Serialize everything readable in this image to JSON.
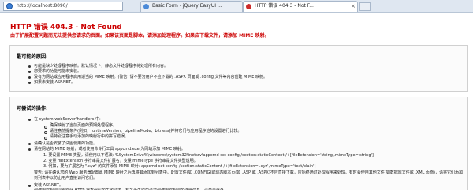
{
  "browser": {
    "address_url": "http://localhost:8090/",
    "tabs": [
      {
        "label": "Basic Form - jQuery EasyUI ..."
      },
      {
        "label": "HTTP 错误 404.3 - Not F..."
      }
    ]
  },
  "error": {
    "title": "HTTP 错误 404.3 - Not Found",
    "subtitle": "由于扩展配置问题而无法提供您请求的页面。如果该页面是脚本，请添加处理程序。如果应下载文件，请添加 MIME 映射。"
  },
  "causes": {
    "heading": "最可能的原因:",
    "items": [
      "可能是缺少处理程序映射。默认情况下，静态文件处理程序将处理所有内容。",
      "您要求的功能可能未安装。",
      "没有为网站或应用程序启用适当的 MIME 映射。(警告: 请不要为用户不应下载的 .ASPX 页面或 .config 文件等内容创建 MIME 映射。)",
      "如果未安装 ASP.NET。"
    ]
  },
  "actions": {
    "heading": "可尝试的操作:",
    "items": [
      {
        "kind": "bullet",
        "text": "在 system.webServer/handlers 中:"
      },
      {
        "kind": "sub",
        "text": "确保映射了当前页面的预期处理程序。"
      },
      {
        "kind": "sub",
        "text": "请注意前提条件(例如，runtimeVersion、pipelineMode、bitness)并将它们与应用程序池的设置进行比较。"
      },
      {
        "kind": "sub",
        "text": "请特别注意手动添加的映射行中的拼写错误。"
      },
      {
        "kind": "bullet",
        "text": "请确认是否安装了试图使用的功能。"
      },
      {
        "kind": "bullet",
        "text": "请在网站的 MIME 映射，或者使用命令行工具 appcmd.exe 为网站添加 MIME 映射。"
      },
      {
        "kind": "num",
        "text": "1. 要设置 MIME 类型，请使用以下语法: %SystemDrive%\\windows\\system32\\inetsrv\\appcmd set config /section:staticContent /+[fileExtension='string',mimeType='string']"
      },
      {
        "kind": "num",
        "text": "2. 变量 fileExtension 字符串是文件扩展名，变量 mimeType 字符串是文件类型说明。"
      },
      {
        "kind": "num",
        "text": "3. 例如，要为扩展名为 \".xyz\" 的文件添加 MIME 映射: appcmd set config /section:staticContent /+[fileExtension='.xyz',mimeType='text/plain']"
      },
      {
        "kind": "plain",
        "text": "警告: 请在确认您的 Web 服务器配置此 MIME 映射之后再将其添加到列表中。配置文件(如 .CONFIG)或动态脚本页(如 .ASP 或 .ASPX)不应直接下载，应始终通过处理程序来处理。有时会使用其他文件(如数据库文件或 .XML 页面)，请将它们添加到列表中以防止用户直接访问它们。"
      },
      {
        "kind": "bullet",
        "text": "安装 ASP.NET。"
      },
      {
        "kind": "bullet",
        "text": "创建跟踪规则以跟踪此 HTTP 状态代码的失败请求。有关为失败的请求创建跟踪规则的详细信息，请单击此处。"
      }
    ]
  }
}
